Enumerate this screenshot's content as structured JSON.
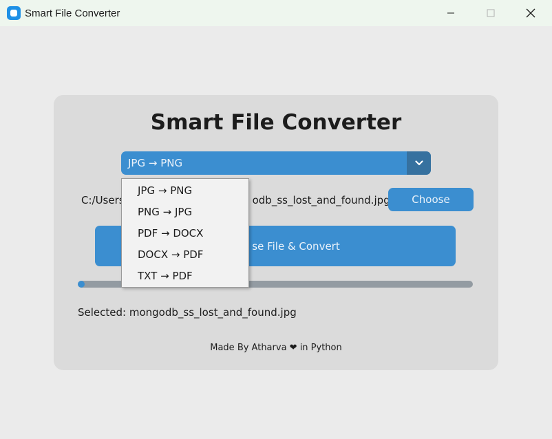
{
  "window": {
    "title": "Smart File Converter"
  },
  "colors": {
    "accent": "#3b8ed0",
    "accent_dark": "#36719f",
    "card": "#dbdbdb",
    "background": "#ebebeb",
    "progress_track": "#939ba2"
  },
  "main": {
    "heading": "Smart File Converter",
    "conversion_select": {
      "value": "JPG → PNG",
      "options": [
        "JPG → PNG",
        "PNG → JPG",
        "PDF → DOCX",
        "DOCX → PDF",
        "TXT → PDF"
      ]
    },
    "path_visible_left": "C:/Users",
    "path_visible_right": "odb_ss_lost_and_found.jpg",
    "choose_label": "Choose",
    "convert_label_visible": "se File & Convert",
    "progress_fraction": 0.01,
    "selected_text": "Selected: mongodb_ss_lost_and_found.jpg",
    "footer": "Made By Atharva ❤ in Python"
  }
}
